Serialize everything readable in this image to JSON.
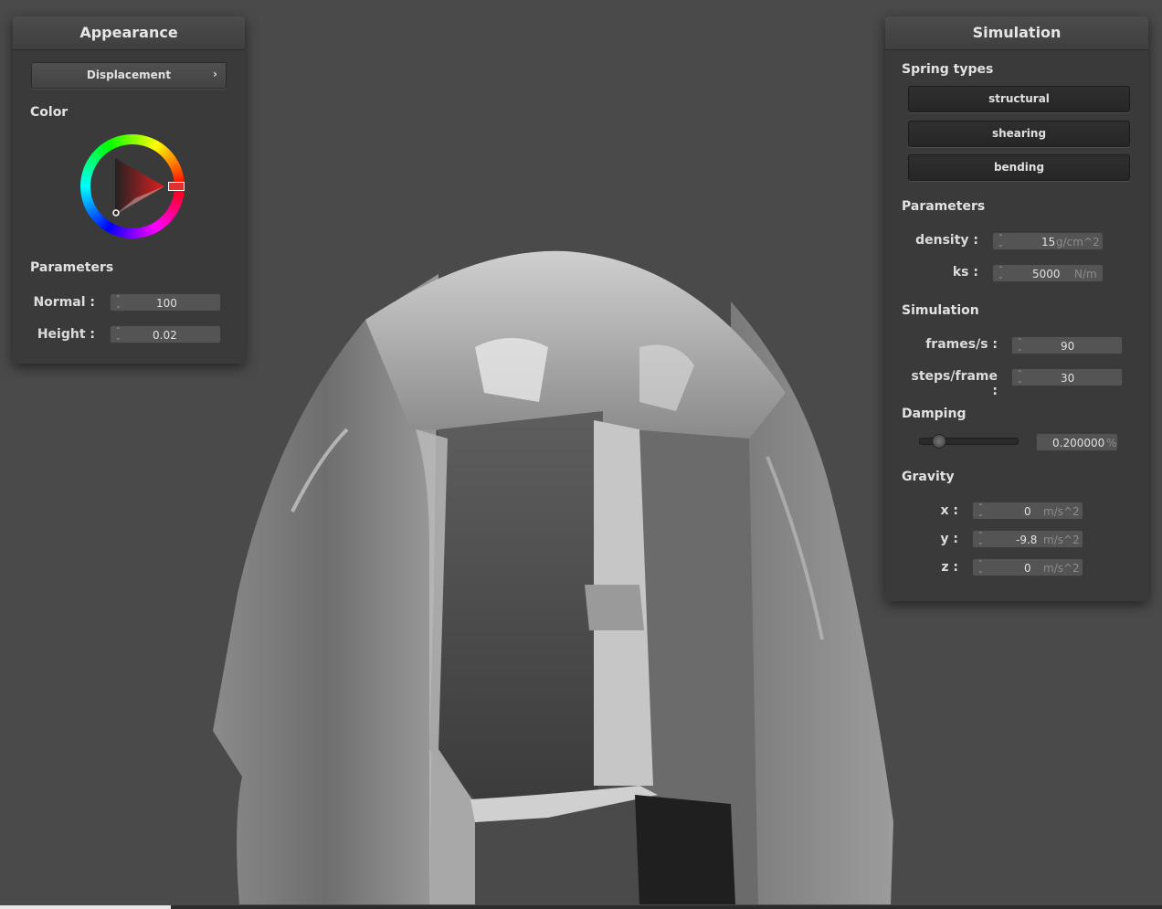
{
  "appearance": {
    "title": "Appearance",
    "shader_select": "Displacement",
    "color_label": "Color",
    "color_hex": "#e03030",
    "params_label": "Parameters",
    "normal": {
      "label": "Normal :",
      "value": "100"
    },
    "height": {
      "label": "Height :",
      "value": "0.02"
    }
  },
  "simulation": {
    "title": "Simulation",
    "spring_types_label": "Spring types",
    "springs": [
      "structural",
      "shearing",
      "bending"
    ],
    "parameters_label": "Parameters",
    "density": {
      "label": "density :",
      "value": "15",
      "unit": "g/cm^2"
    },
    "ks": {
      "label": "ks :",
      "value": "5000",
      "unit": "N/m"
    },
    "sim_label": "Simulation",
    "fps": {
      "label": "frames/s :",
      "value": "90"
    },
    "steps": {
      "label": "steps/frame :",
      "value": "30"
    },
    "damping_label": "Damping",
    "damping": {
      "value": "0.200000",
      "unit": "%",
      "level": 0.2
    },
    "gravity_label": "Gravity",
    "gravity": [
      {
        "label": "x :",
        "value": "0",
        "unit": "m/s^2"
      },
      {
        "label": "y :",
        "value": "-9.8",
        "unit": "m/s^2"
      },
      {
        "label": "z :",
        "value": "0",
        "unit": "m/s^2"
      }
    ]
  }
}
